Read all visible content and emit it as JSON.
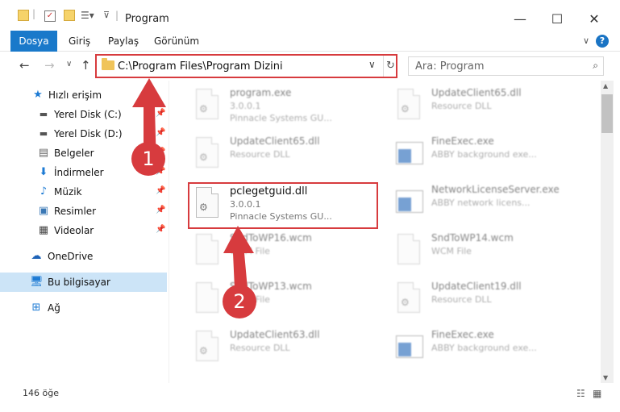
{
  "window": {
    "title": "Program"
  },
  "ribbon": {
    "tabs": [
      "Dosya",
      "Giriş",
      "Paylaş",
      "Görünüm"
    ],
    "help": "?"
  },
  "address": {
    "path": "C:\\Program Files\\Program Dizini"
  },
  "search": {
    "placeholder": "Ara: Program"
  },
  "sidebar": {
    "quick_access": "Hızlı erişim",
    "items": [
      {
        "label": "Yerel Disk (C:)"
      },
      {
        "label": "Yerel Disk (D:)"
      },
      {
        "label": "Belgeler"
      },
      {
        "label": "İndirmeler"
      },
      {
        "label": "Müzik"
      },
      {
        "label": "Resimler"
      },
      {
        "label": "Videolar"
      }
    ],
    "onedrive": "OneDrive",
    "this_pc": "Bu bilgisayar",
    "network": "Ağ"
  },
  "files": [
    {
      "name": "program.exe",
      "line1": "3.0.0.1",
      "line2": "Pinnacle Systems GU..."
    },
    {
      "name": "UpdateClient65.dll",
      "line1": "Resource DLL",
      "line2": ""
    },
    {
      "name": "UpdateClient65.dll",
      "line1": "Resource DLL",
      "line2": ""
    },
    {
      "name": "FineExec.exe",
      "line1": "ABBY background exe...",
      "line2": ""
    },
    {
      "name": "pclegetguid.dll",
      "line1": "3.0.0.1",
      "line2": "Pinnacle Systems GU..."
    },
    {
      "name": "NetworkLicenseServer.exe",
      "line1": "ABBY network licens...",
      "line2": ""
    },
    {
      "name": "SndToWP16.wcm",
      "line1": "WCM File",
      "line2": ""
    },
    {
      "name": "SndToWP14.wcm",
      "line1": "WCM File",
      "line2": ""
    },
    {
      "name": "SndToWP13.wcm",
      "line1": "WCM File",
      "line2": ""
    },
    {
      "name": "UpdateClient19.dll",
      "line1": "Resource DLL",
      "line2": ""
    },
    {
      "name": "UpdateClient63.dll",
      "line1": "Resource DLL",
      "line2": ""
    },
    {
      "name": "FineExec.exe",
      "line1": "ABBY background exe...",
      "line2": ""
    }
  ],
  "status": {
    "count": "146 öğe"
  },
  "annotations": {
    "step1": "1",
    "step2": "2"
  },
  "colors": {
    "accent": "#1979ca",
    "highlight": "#d73b3e",
    "selected": "#cce4f7"
  }
}
